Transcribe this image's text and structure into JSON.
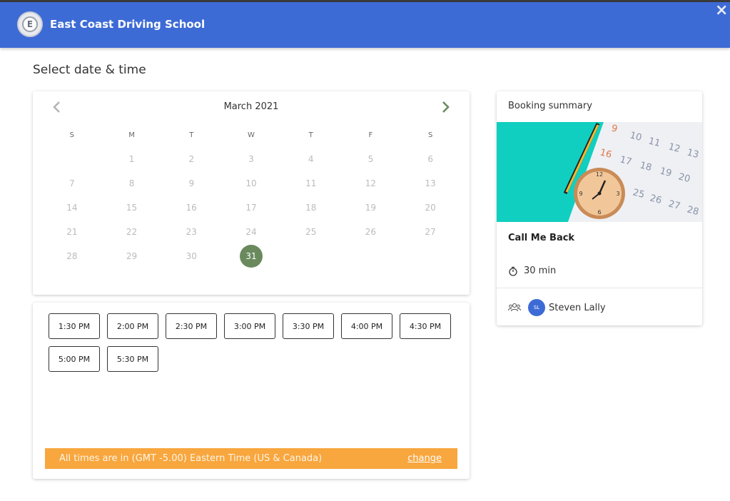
{
  "header": {
    "app_title": "East Coast Driving School",
    "logo_letter": "E",
    "close_icon": "×"
  },
  "page_title": "Select date & time",
  "calendar": {
    "month_label": "March 2021",
    "weekdays": [
      "S",
      "M",
      "T",
      "W",
      "T",
      "F",
      "S"
    ],
    "days": [
      "1",
      "2",
      "3",
      "4",
      "5",
      "6",
      "7",
      "8",
      "9",
      "10",
      "11",
      "12",
      "13",
      "14",
      "15",
      "16",
      "17",
      "18",
      "19",
      "20",
      "21",
      "22",
      "23",
      "24",
      "25",
      "26",
      "27",
      "28",
      "29",
      "30",
      "31"
    ],
    "selected_day": "31",
    "selected_color": "#6a8a5e"
  },
  "time_slots": [
    "1:30 PM",
    "2:00 PM",
    "2:30 PM",
    "3:00 PM",
    "3:30 PM",
    "4:00 PM",
    "4:30 PM",
    "5:00 PM",
    "5:30 PM"
  ],
  "timezone": {
    "text": "All times are in (GMT -5.00) Eastern Time (US & Canada)",
    "change_label": "change",
    "bar_color": "#f8a63e"
  },
  "summary": {
    "heading": "Booking summary",
    "service_name": "Call Me Back",
    "duration": "30 min",
    "staff_initials": "SL",
    "staff_name": "Steven Lally"
  },
  "colors": {
    "header": "#3d6bd6",
    "accent": "#6a8a5e"
  }
}
